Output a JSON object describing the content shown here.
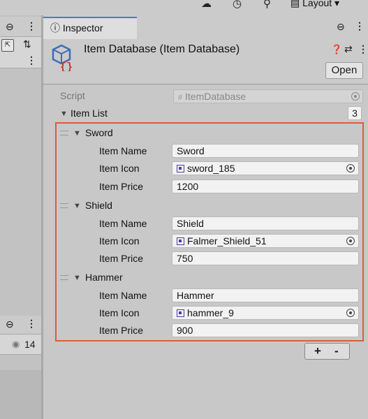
{
  "toolbar": {
    "layout_label": "Layout ▾"
  },
  "left_panel": {
    "count_badge": "14"
  },
  "inspector": {
    "tab_label": "Inspector",
    "title": "Item Database (Item Database)",
    "open_label": "Open",
    "script_label": "Script",
    "script_value": "ItemDatabase",
    "list_label": "Item List",
    "list_count": "3",
    "items": [
      {
        "header": "Sword",
        "name_label": "Item Name",
        "name": "Sword",
        "icon_label": "Item Icon",
        "icon": "sword_185",
        "price_label": "Item Price",
        "price": "1200"
      },
      {
        "header": "Shield",
        "name_label": "Item Name",
        "name": "Shield",
        "icon_label": "Item Icon",
        "icon": "Falmer_Shield_51",
        "price_label": "Item Price",
        "price": "750"
      },
      {
        "header": "Hammer",
        "name_label": "Item Name",
        "name": "Hammer",
        "icon_label": "Item Icon",
        "icon": "hammer_9",
        "price_label": "Item Price",
        "price": "900"
      }
    ],
    "add_label": "+",
    "remove_label": "-"
  },
  "colors": {
    "highlight_border": "#e05a3c",
    "tab_accent": "#3b7de0"
  }
}
